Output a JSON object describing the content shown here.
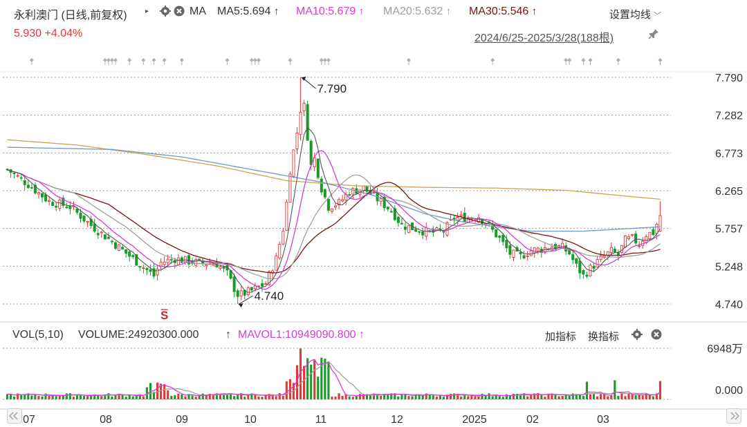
{
  "header": {
    "title": "永利澳门 (日线,前复权)",
    "ma_label": "MA",
    "ma5": "MA5:5.694",
    "ma10": "MA10:5.679",
    "ma20": "MA20:5.632",
    "ma30": "MA30:5.546",
    "arrow": "↑",
    "settings": "设置均线",
    "price": "5.930",
    "change": "+4.04%",
    "range": "2024/6/25-2025/3/28(188根)"
  },
  "volume_header": {
    "vol": "VOL(5,10)",
    "volume": "VOLUME:24920300.000",
    "mavol": "MAVOL1:10949090.800",
    "arrow": "↑",
    "add_indicator": "加指标",
    "switch_indicator": "换指标"
  },
  "colors": {
    "up": "#e03838",
    "down": "#1a9a2a",
    "ma5": "#555555",
    "ma10": "#d63bd6",
    "ma20": "#9e9e9e",
    "ma30": "#7a1212",
    "ma_long": "#c9a64c",
    "ma_blue": "#6f98c8",
    "grid": "#999999"
  },
  "icons": [
    "gear-icon",
    "close-icon",
    "pin-icon",
    "scroll-left-icon",
    "scroll-right-icon",
    "settings-dropdown-icon"
  ],
  "chart_data": {
    "type": "candlestick",
    "y_ticks": [
      "7.790",
      "7.282",
      "6.773",
      "6.265",
      "5.757",
      "5.248",
      "4.740"
    ],
    "ylim": [
      4.74,
      7.79
    ],
    "x_ticks": [
      "07",
      "08",
      "09",
      "10",
      "11",
      "12",
      "2025",
      "02",
      "03"
    ],
    "annotations": [
      {
        "label": "7.790",
        "value": 7.79,
        "kind": "high"
      },
      {
        "label": "4.740",
        "value": 4.74,
        "kind": "low"
      }
    ],
    "signal_marker": "S",
    "series": [
      {
        "name": "MA5",
        "value": 5.694
      },
      {
        "name": "MA10",
        "value": 5.679
      },
      {
        "name": "MA20",
        "value": 5.632
      },
      {
        "name": "MA30",
        "value": 5.546
      }
    ],
    "price_anchors": [
      [
        0,
        6.55
      ],
      [
        6,
        6.35
      ],
      [
        12,
        6.12
      ],
      [
        18,
        6.05
      ],
      [
        24,
        5.8
      ],
      [
        30,
        5.58
      ],
      [
        36,
        5.35
      ],
      [
        42,
        5.12
      ],
      [
        44,
        5.3
      ],
      [
        48,
        5.35
      ],
      [
        54,
        5.3
      ],
      [
        60,
        5.28
      ],
      [
        63,
        5.15
      ],
      [
        66,
        4.85
      ],
      [
        70,
        4.92
      ],
      [
        74,
        5.02
      ],
      [
        77,
        5.35
      ],
      [
        79,
        5.75
      ],
      [
        80,
        6.1
      ],
      [
        81,
        6.55
      ],
      [
        82,
        6.8
      ],
      [
        83,
        7.05
      ],
      [
        84,
        7.3
      ],
      [
        85,
        7.4
      ],
      [
        86,
        7.0
      ],
      [
        87,
        6.6
      ],
      [
        88,
        6.7
      ],
      [
        90,
        6.3
      ],
      [
        92,
        6.05
      ],
      [
        95,
        6.1
      ],
      [
        98,
        6.25
      ],
      [
        102,
        6.3
      ],
      [
        106,
        6.15
      ],
      [
        110,
        6.0
      ],
      [
        113,
        5.8
      ],
      [
        117,
        5.75
      ],
      [
        121,
        5.7
      ],
      [
        125,
        5.72
      ],
      [
        128,
        5.9
      ],
      [
        131,
        5.9
      ],
      [
        135,
        5.92
      ],
      [
        138,
        5.78
      ],
      [
        141,
        5.62
      ],
      [
        144,
        5.42
      ],
      [
        147,
        5.38
      ],
      [
        150,
        5.46
      ],
      [
        153,
        5.48
      ],
      [
        156,
        5.52
      ],
      [
        159,
        5.5
      ],
      [
        161,
        5.42
      ],
      [
        163,
        5.25
      ],
      [
        165,
        5.12
      ],
      [
        167,
        5.22
      ],
      [
        170,
        5.35
      ],
      [
        173,
        5.45
      ],
      [
        175,
        5.4
      ],
      [
        177,
        5.6
      ],
      [
        179,
        5.62
      ],
      [
        181,
        5.55
      ],
      [
        183,
        5.68
      ],
      [
        185,
        5.7
      ],
      [
        187,
        5.93
      ]
    ],
    "ma_long_anchors": [
      [
        0,
        6.95
      ],
      [
        20,
        6.88
      ],
      [
        40,
        6.75
      ],
      [
        60,
        6.6
      ],
      [
        80,
        6.4
      ],
      [
        100,
        6.33
      ],
      [
        120,
        6.31
      ],
      [
        140,
        6.3
      ],
      [
        160,
        6.27
      ],
      [
        180,
        6.18
      ],
      [
        187,
        6.15
      ]
    ],
    "ma_blue_anchors": [
      [
        0,
        6.85
      ],
      [
        30,
        6.82
      ],
      [
        50,
        6.72
      ],
      [
        70,
        6.55
      ],
      [
        90,
        6.38
      ],
      [
        105,
        6.2
      ],
      [
        120,
        5.95
      ],
      [
        130,
        5.85
      ],
      [
        140,
        5.78
      ],
      [
        150,
        5.72
      ],
      [
        165,
        5.72
      ],
      [
        180,
        5.76
      ],
      [
        187,
        5.78
      ]
    ],
    "volume": {
      "y_ticks": [
        "6948万",
        "0.000"
      ],
      "max": 69480000,
      "last": 24920300,
      "mavol1": 10949090.8
    }
  }
}
